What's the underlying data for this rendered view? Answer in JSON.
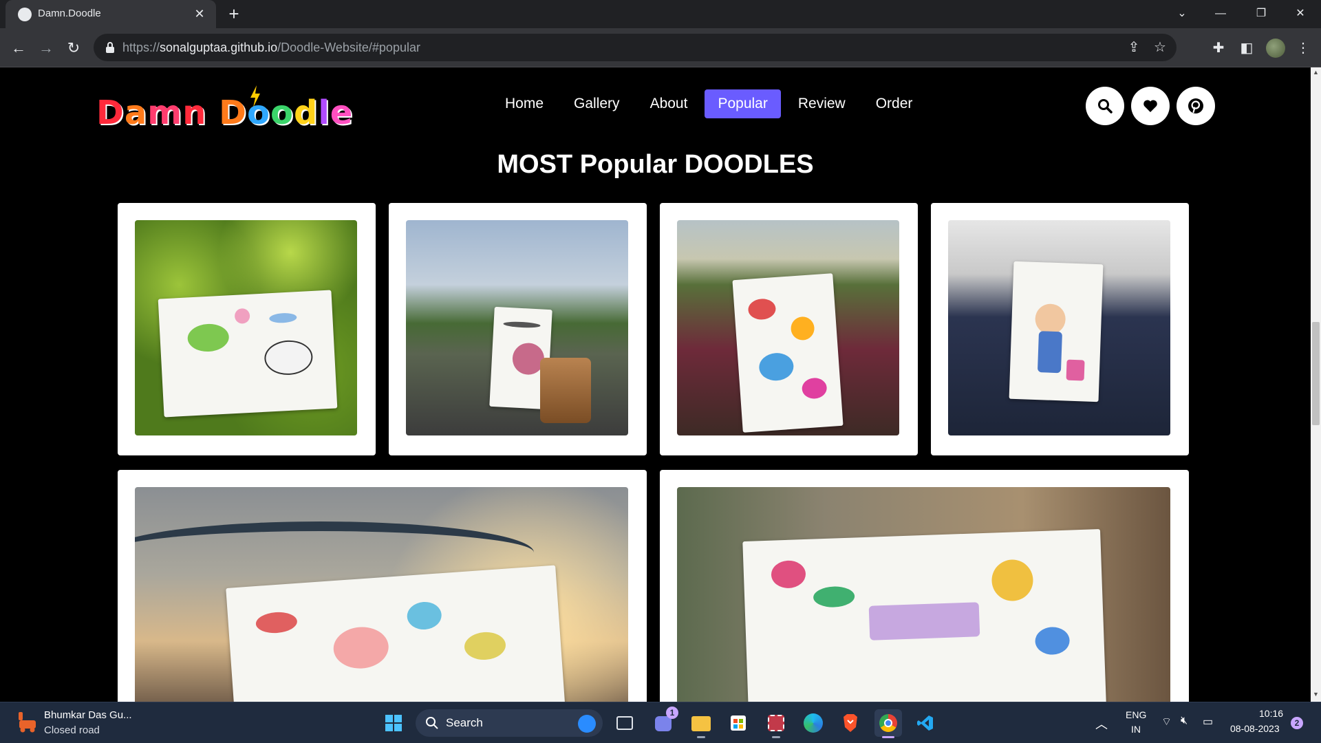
{
  "browser": {
    "tab_title": "Damn.Doodle",
    "tab_close": "✕",
    "new_tab": "+",
    "url_prefix": "https://",
    "url_host": "sonalguptaa.github.io",
    "url_path": "/Doodle-Website/#popular"
  },
  "site": {
    "logo_text": "Damn Doodle",
    "logo_letters": [
      {
        "ch": "D",
        "color": "#ff2a3b"
      },
      {
        "ch": "a",
        "color": "#ff7a1a"
      },
      {
        "ch": "m",
        "color": "#ff3d6e"
      },
      {
        "ch": "n",
        "color": "#ff2a3b"
      },
      {
        "ch": " ",
        "color": "#000000"
      },
      {
        "ch": "D",
        "color": "#ff7a1a"
      },
      {
        "ch": "o",
        "color": "#2fa8ff"
      },
      {
        "ch": "o",
        "color": "#3bd46a"
      },
      {
        "ch": "d",
        "color": "#ffd21a"
      },
      {
        "ch": "l",
        "color": "#b14bff"
      },
      {
        "ch": "e",
        "color": "#ff4fc0"
      }
    ],
    "nav": [
      "Home",
      "Gallery",
      "About",
      "Popular",
      "Review",
      "Order"
    ],
    "nav_active": "Popular",
    "accent": "#6a5cff",
    "icon_buttons": [
      "search-icon",
      "heart-icon",
      "pinterest-icon"
    ]
  },
  "section": {
    "title": "MOST Popular DOODLES"
  },
  "taskbar": {
    "weather_title": "Bhumkar Das Gu...",
    "weather_sub": "Closed road",
    "search_label": "Search",
    "lang_1": "ENG",
    "lang_2": "IN",
    "time": "10:16",
    "date": "08-08-2023",
    "teams_badge": "1",
    "notif_badge": "2"
  }
}
